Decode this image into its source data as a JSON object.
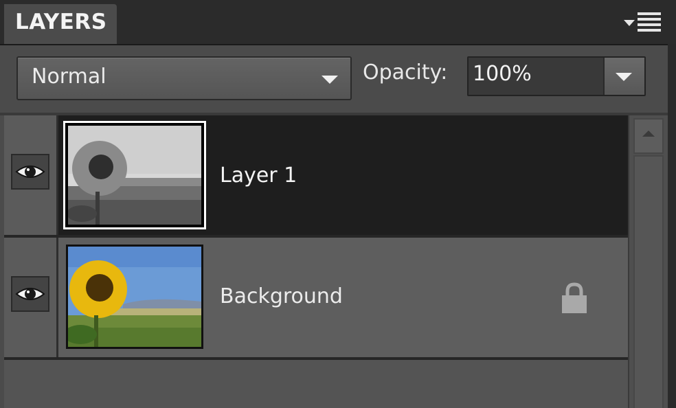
{
  "panel": {
    "tab_title": "LAYERS",
    "menu_icon": "panel-menu-icon"
  },
  "controls": {
    "blend_mode": "Normal",
    "opacity_label": "Opacity:",
    "opacity_value": "100%"
  },
  "layers": [
    {
      "name": "Layer 1",
      "visible": true,
      "selected": true,
      "locked": false,
      "thumbnail": "grayscale-sunflower"
    },
    {
      "name": "Background",
      "visible": true,
      "selected": false,
      "locked": true,
      "thumbnail": "color-sunflower"
    }
  ],
  "colors": {
    "panel_bg": "#4b4b4b",
    "selected_row": "#1e1e1e",
    "row_bg": "#5e5e5e",
    "text": "#f0f0f0"
  }
}
